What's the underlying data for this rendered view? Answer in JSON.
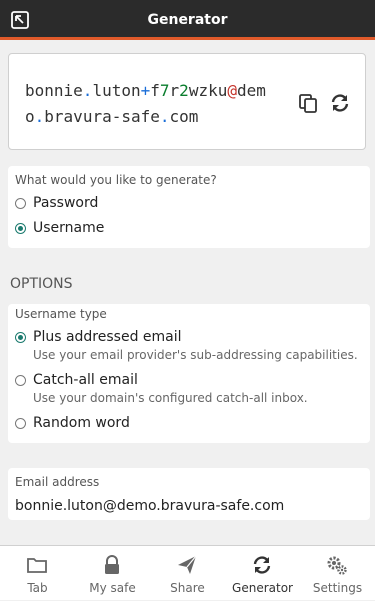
{
  "header": {
    "title": "Generator"
  },
  "generated": {
    "parts": [
      {
        "t": "bonnie",
        "c": "txt"
      },
      {
        "t": ".",
        "c": "sp"
      },
      {
        "t": "luton",
        "c": "txt"
      },
      {
        "t": "+",
        "c": "sp"
      },
      {
        "t": "f",
        "c": "txt"
      },
      {
        "t": "7",
        "c": "nm"
      },
      {
        "t": "r",
        "c": "txt"
      },
      {
        "t": "2",
        "c": "nm"
      },
      {
        "t": "wzku",
        "c": "txt"
      },
      {
        "t": "@",
        "c": "at"
      },
      {
        "t": "demo",
        "c": "txt"
      },
      {
        "t": ".",
        "c": "sp"
      },
      {
        "t": "bravura-safe",
        "c": "txt"
      },
      {
        "t": ".",
        "c": "sp"
      },
      {
        "t": "com",
        "c": "txt"
      }
    ]
  },
  "type_card": {
    "question": "What would you like to generate?",
    "options": [
      {
        "label": "Password",
        "selected": false
      },
      {
        "label": "Username",
        "selected": true
      }
    ]
  },
  "options_title": "OPTIONS",
  "username_card": {
    "label": "Username type",
    "options": [
      {
        "label": "Plus addressed email",
        "desc": "Use your email provider's sub-addressing capabilities.",
        "selected": true
      },
      {
        "label": "Catch-all email",
        "desc": "Use your domain's configured catch-all inbox.",
        "selected": false
      },
      {
        "label": "Random word",
        "desc": "",
        "selected": false
      }
    ]
  },
  "email_card": {
    "label": "Email address",
    "value": "bonnie.luton@demo.bravura-safe.com"
  },
  "tabs": [
    {
      "label": "Tab",
      "icon": "folder-icon",
      "active": false
    },
    {
      "label": "My safe",
      "icon": "lock-icon",
      "active": false
    },
    {
      "label": "Share",
      "icon": "send-icon",
      "active": false
    },
    {
      "label": "Generator",
      "icon": "refresh-icon",
      "active": true
    },
    {
      "label": "Settings",
      "icon": "gears-icon",
      "active": false
    }
  ],
  "colors": {
    "accent": "#e05a2a",
    "header": "#2b2b2b",
    "radio": "#1b7a6e"
  }
}
